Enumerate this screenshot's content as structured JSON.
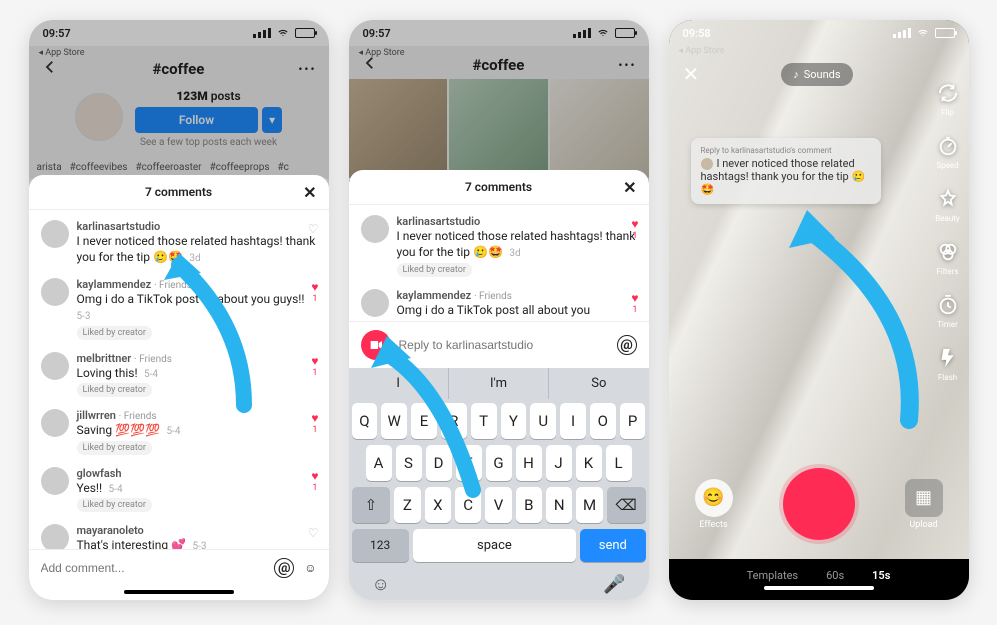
{
  "status": {
    "time1": "09:57",
    "time2": "09:57",
    "time3": "09:58",
    "back_app": "App Store"
  },
  "hashtag": {
    "title": "#coffee",
    "posts_count": "123M",
    "posts_label": "posts",
    "follow": "Follow",
    "subtext": "See a few top posts each week",
    "related": [
      "arista",
      "#coffeevibes",
      "#coffeeroaster",
      "#coffeeprops",
      "#c"
    ]
  },
  "sheet": {
    "title": "7 comments",
    "add_placeholder": "Add comment...",
    "liked_by_creator": "Liked by creator"
  },
  "comments": [
    {
      "user": "karlinasartstudio",
      "meta": "",
      "text": "I never noticed those related hashtags! thank you for the tip 🥲🤩",
      "time": "3d",
      "likes": "",
      "liked": false,
      "liked_creator": false
    },
    {
      "user": "kaylammendez",
      "meta": "Friends",
      "text": "Omg i do a TikTok post all about you guys!!",
      "time": "5-3",
      "likes": "1",
      "liked": true,
      "liked_creator": true
    },
    {
      "user": "melbrittner",
      "meta": "Friends",
      "text": "Loving this!",
      "time": "5-4",
      "likes": "1",
      "liked": true,
      "liked_creator": true
    },
    {
      "user": "jillwrren",
      "meta": "Friends",
      "text": "Saving 💯💯💯",
      "time": "5-4",
      "likes": "1",
      "liked": true,
      "liked_creator": true
    },
    {
      "user": "glowfash",
      "meta": "",
      "text": "Yes!!",
      "time": "5-4",
      "likes": "1",
      "liked": true,
      "liked_creator": true
    },
    {
      "user": "mayaranoleto",
      "meta": "",
      "text": "That's interesting 💕",
      "time": "5-3",
      "likes": "",
      "liked": false,
      "liked_creator": false
    }
  ],
  "comments2": [
    {
      "user": "karlinasartstudio",
      "meta": "",
      "text": "I never noticed those related hashtags! thank you for the tip 🥲🤩",
      "time": "3d",
      "likes": "1",
      "liked": true,
      "liked_creator": true
    },
    {
      "user": "kaylammendez",
      "meta": "Friends",
      "text": "Omg i do a TikTok post all about you",
      "time": "",
      "likes": "1",
      "liked": true,
      "liked_creator": false
    }
  ],
  "reply": {
    "placeholder": "Reply to karlinasartstudio"
  },
  "keyboard": {
    "suggestions": [
      "I",
      "I'm",
      "So"
    ],
    "row1": [
      "Q",
      "W",
      "E",
      "R",
      "T",
      "Y",
      "U",
      "I",
      "O",
      "P"
    ],
    "row2": [
      "A",
      "S",
      "D",
      "F",
      "G",
      "H",
      "J",
      "K",
      "L"
    ],
    "row3": [
      "Z",
      "X",
      "C",
      "V",
      "B",
      "N",
      "M"
    ],
    "numkey": "123",
    "space": "space",
    "send": "send"
  },
  "camera": {
    "sounds": "Sounds",
    "tools": [
      "Flip",
      "Speed",
      "Beauty",
      "Filters",
      "Timer",
      "Flash"
    ],
    "bubble_title": "Reply to karlinasartstudio's comment",
    "bubble_text": "I never noticed those related hashtags! thank you for the tip 🥲🤩",
    "effects": "Effects",
    "upload": "Upload",
    "modes": [
      "Templates",
      "60s",
      "15s"
    ],
    "active_mode": "15s"
  }
}
